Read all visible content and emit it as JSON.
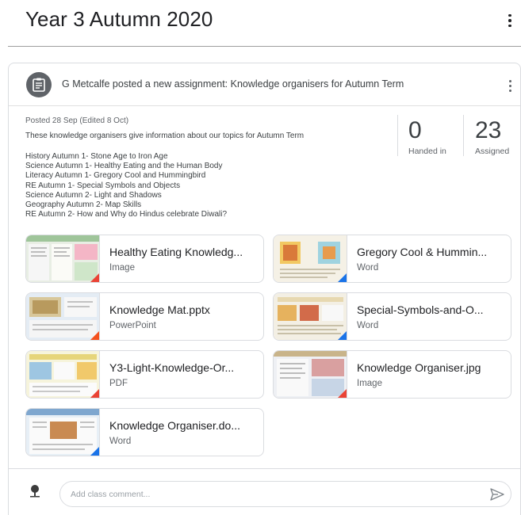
{
  "page": {
    "title": "Year 3 Autumn 2020"
  },
  "post": {
    "header": "G Metcalfe posted a new assignment: Knowledge organisers for Autumn Term",
    "posted": "Posted 28 Sep (Edited 8 Oct)",
    "description": "These knowledge organisers give information about our topics for Autumn Term",
    "topics": [
      "History Autumn 1- Stone Age to Iron Age",
      "Science Autumn 1- Healthy Eating and the Human Body",
      "Literacy Autumn 1- Gregory Cool and Hummingbird",
      "RE Autumn 1- Special Symbols and Objects",
      "Science Autumn 2- Light and Shadows",
      "Geography Autumn 2- Map Skills",
      "RE Autumn 2- How and Why do Hindus celebrate Diwali?"
    ],
    "stats": {
      "handed_in": {
        "value": "0",
        "label": "Handed in"
      },
      "assigned": {
        "value": "23",
        "label": "Assigned"
      }
    }
  },
  "attachments": [
    {
      "name": "Healthy Eating Knowledg...",
      "type": "Image",
      "icon": "image-corner-icon",
      "corner_color": "#ea4335"
    },
    {
      "name": "Gregory Cool & Hummin...",
      "type": "Word",
      "icon": "word-corner-icon",
      "corner_color": "#1a73e8"
    },
    {
      "name": "Knowledge Mat.pptx",
      "type": "PowerPoint",
      "icon": "powerpoint-corner-icon",
      "corner_color": "#f4511e"
    },
    {
      "name": "Special-Symbols-and-O...",
      "type": "Word",
      "icon": "word-corner-icon",
      "corner_color": "#1a73e8"
    },
    {
      "name": "Y3-Light-Knowledge-Or...",
      "type": "PDF",
      "icon": "pdf-corner-icon",
      "corner_color": "#ea4335"
    },
    {
      "name": "Knowledge Organiser.jpg",
      "type": "Image",
      "icon": "image-corner-icon",
      "corner_color": "#ea4335"
    },
    {
      "name": "Knowledge Organiser.do...",
      "type": "Word",
      "icon": "word-corner-icon",
      "corner_color": "#1a73e8"
    }
  ],
  "comment": {
    "placeholder": "Add class comment..."
  },
  "colors": {
    "word": "#1a73e8",
    "pdf_image": "#ea4335",
    "powerpoint": "#f4511e",
    "icon_grey": "#5f6368"
  }
}
